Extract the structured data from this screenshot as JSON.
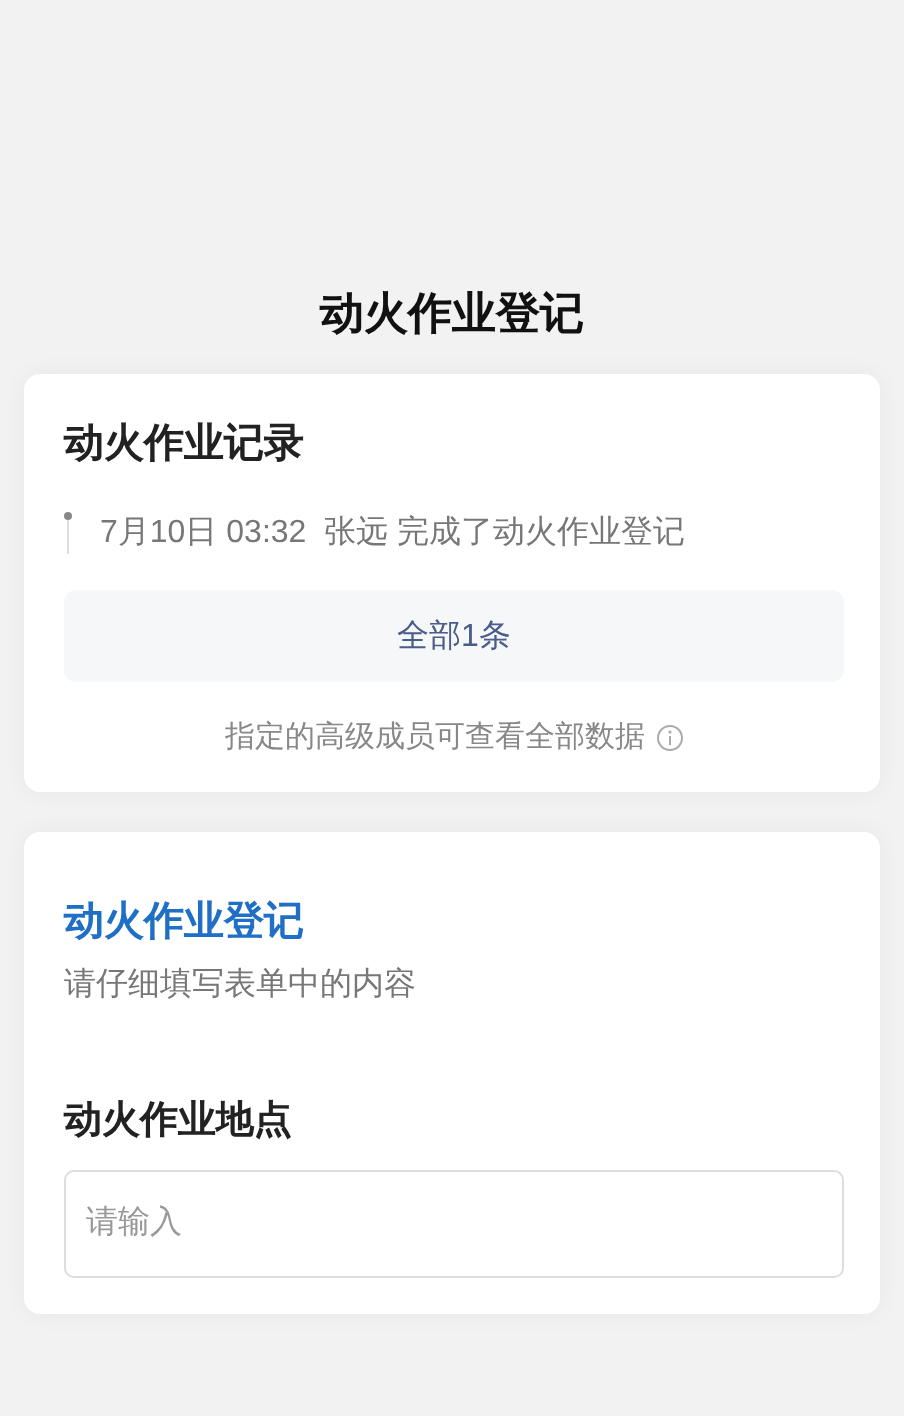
{
  "page_title": "动火作业登记",
  "records": {
    "title": "动火作业记录",
    "entries": [
      {
        "time": "7月10日 03:32",
        "user": "张远",
        "action": "完成了动火作业登记"
      }
    ],
    "all_button": "全部1条",
    "note": "指定的高级成员可查看全部数据"
  },
  "form": {
    "title": "动火作业登记",
    "subtitle": "请仔细填写表单中的内容",
    "fields": [
      {
        "label": "动火作业地点",
        "placeholder": "请输入"
      }
    ]
  }
}
